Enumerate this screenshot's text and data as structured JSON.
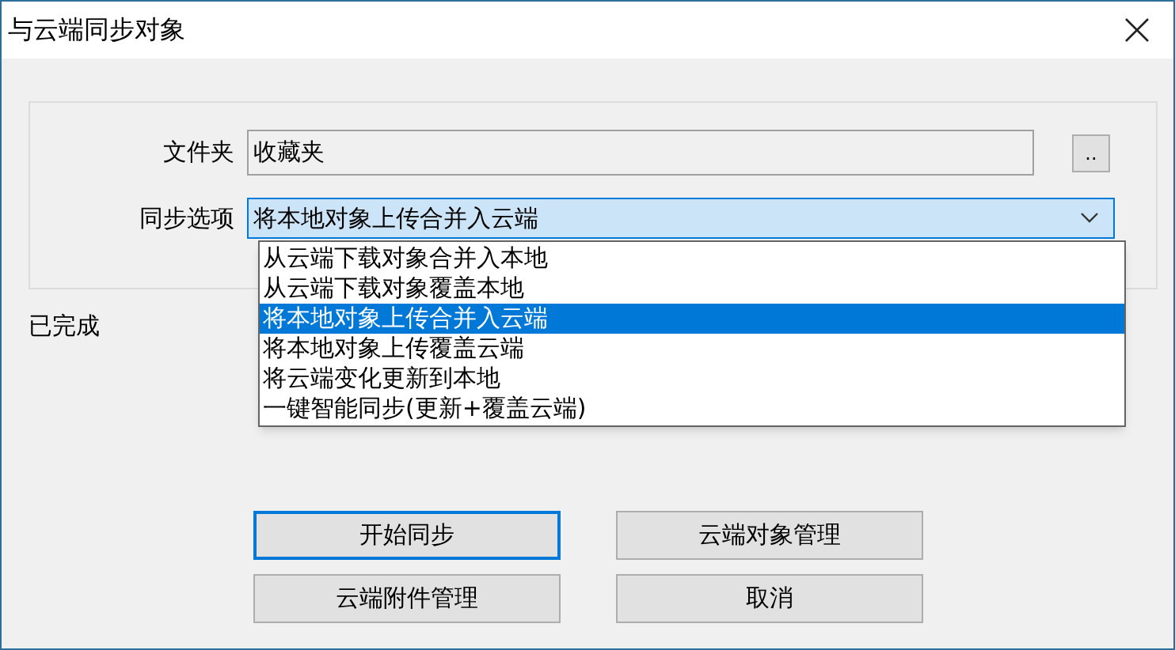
{
  "window": {
    "title": "与云端同步对象"
  },
  "folder": {
    "label": "文件夹",
    "value": "收藏夹",
    "browse_button": ".."
  },
  "sync_option": {
    "label": "同步选项",
    "value": "将本地对象上传合并入云端",
    "expanded": true,
    "options": [
      {
        "label": "从云端下载对象合并入本地",
        "selected": false
      },
      {
        "label": "从云端下载对象覆盖本地",
        "selected": false
      },
      {
        "label": "将本地对象上传合并入云端",
        "selected": true
      },
      {
        "label": "将本地对象上传覆盖云端",
        "selected": false
      },
      {
        "label": "将云端变化更新到本地",
        "selected": false
      },
      {
        "label": "一键智能同步(更新+覆盖云端)",
        "selected": false
      }
    ]
  },
  "status": "已完成",
  "buttons": [
    {
      "label": "开始同步",
      "default": true
    },
    {
      "label": "云端对象管理",
      "default": false
    },
    {
      "label": "云端附件管理",
      "default": false
    },
    {
      "label": "取消",
      "default": false
    }
  ]
}
